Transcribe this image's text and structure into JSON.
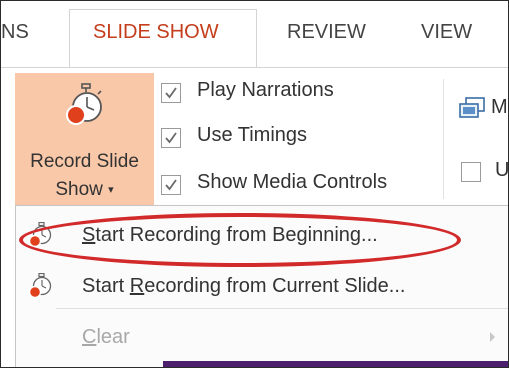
{
  "tabs": {
    "left_partial": "NS",
    "active": "SLIDE SHOW",
    "review": "REVIEW",
    "view": "VIEW"
  },
  "record": {
    "line1": "Record Slide",
    "line2": "Show",
    "caret": "▾",
    "icon": "stopwatch-record-icon"
  },
  "checkboxes": [
    {
      "label": "Play Narrations",
      "checked": true
    },
    {
      "label": "Use Timings",
      "checked": true
    },
    {
      "label": "Show Media Controls",
      "checked": true
    }
  ],
  "monitors": {
    "icon": "monitor-icon",
    "label_partial": "M",
    "use_label_partial": "U",
    "use_checked": false
  },
  "menu": {
    "items": [
      {
        "prefix": "",
        "mnemonic": "S",
        "rest": "tart Recording from Beginning...",
        "enabled": true,
        "icon": "stopwatch-record-icon"
      },
      {
        "prefix": "Start ",
        "mnemonic": "R",
        "rest": "ecording from Current Slide...",
        "enabled": true,
        "icon": "stopwatch-record-icon"
      },
      {
        "prefix": "",
        "mnemonic": "C",
        "rest": "lear",
        "enabled": false,
        "has_submenu": true
      }
    ]
  },
  "colors": {
    "active_tab": "#c43e1c",
    "record_button_bg": "#f9c8a8",
    "highlight_ring": "#d22a2a",
    "slide_bar": "#4b1f6b"
  }
}
